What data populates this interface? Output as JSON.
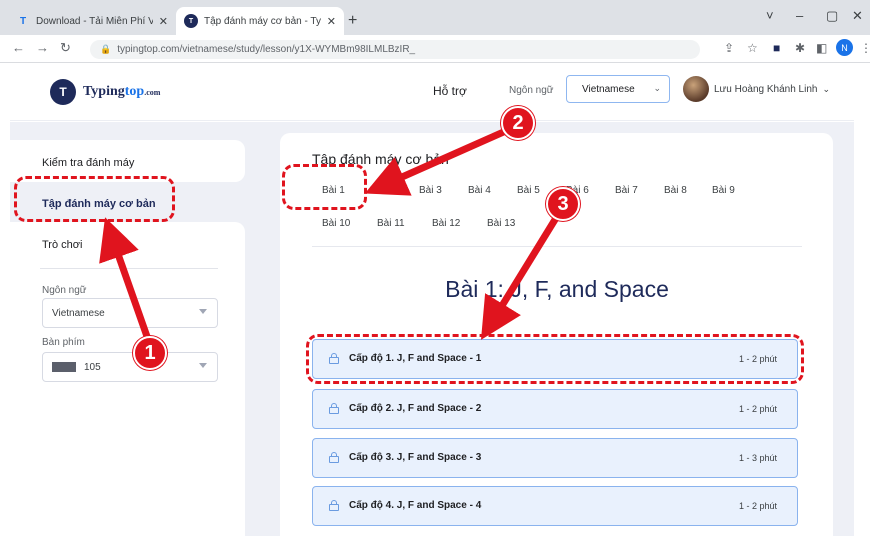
{
  "browser": {
    "tabs": [
      {
        "title": "Download - Tải Miễn Phí VN - Phần",
        "favicon": "T"
      },
      {
        "title": "Tập đánh máy cơ bản - TypingTop",
        "favicon": "T"
      }
    ],
    "new_tab": "+",
    "url": "typingtop.com/vietnamese/study/lesson/y1X-WYMBm98ILMLBzIR_",
    "profile_initial": "N",
    "window_controls": [
      "˅",
      "–",
      "▢",
      "✕"
    ]
  },
  "header": {
    "logo_mark": "T",
    "logo_text_main": "Typing",
    "logo_text_accent": "top",
    "logo_text_suffix": ".com",
    "help": "Hỗ trợ",
    "language_label": "Ngôn ngữ",
    "language_value": "Vietnamese",
    "user_name": "Lưu Hoàng Khánh Linh"
  },
  "sidebar": {
    "items": [
      {
        "label": "Kiểm tra đánh máy"
      },
      {
        "label": "Tập đánh máy cơ bản"
      },
      {
        "label": "Trò chơi"
      }
    ],
    "language_label": "Ngôn ngữ",
    "language_value": "Vietnamese",
    "keyboard_label": "Bàn phím",
    "keyboard_value": "105"
  },
  "main": {
    "section_title": "Tập đánh máy cơ bản",
    "lessons": [
      "Bài 1",
      "Bài 2",
      "Bài 3",
      "Bài 4",
      "Bài 5",
      "Bài 6",
      "Bài 7",
      "Bài 8",
      "Bài 9",
      "Bài 10",
      "Bài 11",
      "Bài 12",
      "Bài 13"
    ],
    "lesson_heading": "Bài 1: J, F, and Space",
    "levels": [
      {
        "name": "Cấp độ 1. J, F and Space - 1",
        "duration": "1 - 2 phút"
      },
      {
        "name": "Cấp độ 2. J, F and Space - 2",
        "duration": "1 - 2 phút"
      },
      {
        "name": "Cấp độ 3. J, F and Space - 3",
        "duration": "1 - 3 phút"
      },
      {
        "name": "Cấp độ 4. J, F and Space - 4",
        "duration": "1 - 2 phút"
      }
    ]
  },
  "annotations": {
    "badges": [
      "1",
      "2",
      "3"
    ],
    "color": "#e0141e"
  }
}
